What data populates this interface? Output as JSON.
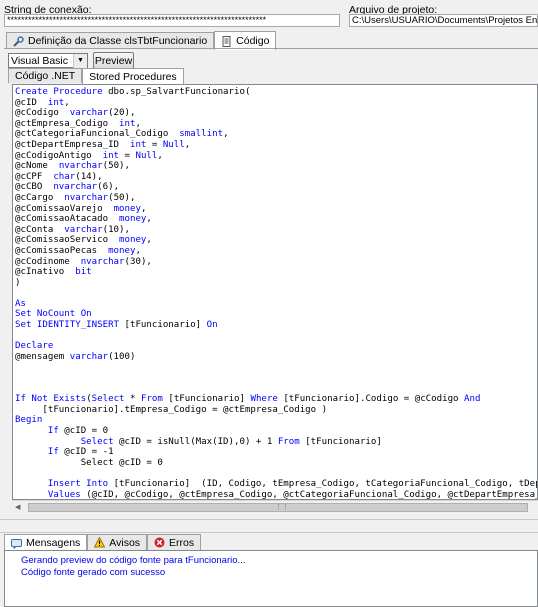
{
  "connection": {
    "label": "String de conexão:",
    "value": "**************************************************************************"
  },
  "project": {
    "label": "Arquivo de projeto:",
    "value": "C:\\Users\\USUARIO\\Documents\\Projetos Entity\\SGLPDES"
  },
  "top_tabs": [
    {
      "label": "Definição da Classe clsTbtFuncionario",
      "icon": "wrench-icon"
    },
    {
      "label": "Código",
      "icon": "page-icon"
    }
  ],
  "language": {
    "selected": "Visual Basic",
    "preview_label": "Preview"
  },
  "code_tabs": [
    {
      "label": "Código .NET"
    },
    {
      "label": "Stored Procedures"
    }
  ],
  "code_lines": [
    [
      [
        "kw",
        "Create Procedure "
      ],
      [
        "tx",
        "dbo.sp_SalvartFuncionario("
      ]
    ],
    [
      [
        "tx",
        "@cID  "
      ],
      [
        "kw",
        "int"
      ],
      [
        "tx",
        ","
      ]
    ],
    [
      [
        "tx",
        "@cCodigo  "
      ],
      [
        "kw",
        "varchar"
      ],
      [
        "tx",
        "(20),"
      ]
    ],
    [
      [
        "tx",
        "@ctEmpresa_Codigo  "
      ],
      [
        "kw",
        "int"
      ],
      [
        "tx",
        ","
      ]
    ],
    [
      [
        "tx",
        "@ctCategoriaFuncional_Codigo  "
      ],
      [
        "kw",
        "smallint"
      ],
      [
        "tx",
        ","
      ]
    ],
    [
      [
        "tx",
        "@ctDepartEmpresa_ID  "
      ],
      [
        "kw",
        "int"
      ],
      [
        "tx",
        " = "
      ],
      [
        "kw",
        "Null"
      ],
      [
        "tx",
        ","
      ]
    ],
    [
      [
        "tx",
        "@cCodigoAntigo  "
      ],
      [
        "kw",
        "int"
      ],
      [
        "tx",
        " = "
      ],
      [
        "kw",
        "Null"
      ],
      [
        "tx",
        ","
      ]
    ],
    [
      [
        "tx",
        "@cNome  "
      ],
      [
        "kw",
        "nvarchar"
      ],
      [
        "tx",
        "(50),"
      ]
    ],
    [
      [
        "tx",
        "@cCPF  "
      ],
      [
        "kw",
        "char"
      ],
      [
        "tx",
        "(14),"
      ]
    ],
    [
      [
        "tx",
        "@cCBO  "
      ],
      [
        "kw",
        "nvarchar"
      ],
      [
        "tx",
        "(6),"
      ]
    ],
    [
      [
        "tx",
        "@cCargo  "
      ],
      [
        "kw",
        "nvarchar"
      ],
      [
        "tx",
        "(50),"
      ]
    ],
    [
      [
        "tx",
        "@cComissaoVarejo  "
      ],
      [
        "kw",
        "money"
      ],
      [
        "tx",
        ","
      ]
    ],
    [
      [
        "tx",
        "@cComissaoAtacado  "
      ],
      [
        "kw",
        "money"
      ],
      [
        "tx",
        ","
      ]
    ],
    [
      [
        "tx",
        "@cConta  "
      ],
      [
        "kw",
        "varchar"
      ],
      [
        "tx",
        "(10),"
      ]
    ],
    [
      [
        "tx",
        "@cComissaoServico  "
      ],
      [
        "kw",
        "money"
      ],
      [
        "tx",
        ","
      ]
    ],
    [
      [
        "tx",
        "@cComissaoPecas  "
      ],
      [
        "kw",
        "money"
      ],
      [
        "tx",
        ","
      ]
    ],
    [
      [
        "tx",
        "@cCodinome  "
      ],
      [
        "kw",
        "nvarchar"
      ],
      [
        "tx",
        "(30),"
      ]
    ],
    [
      [
        "tx",
        "@cInativo  "
      ],
      [
        "kw",
        "bit"
      ]
    ],
    [
      [
        "tx",
        ")"
      ]
    ],
    [],
    [
      [
        "kw",
        "As"
      ]
    ],
    [
      [
        "kw",
        "Set NoCount On"
      ]
    ],
    [
      [
        "kw",
        "Set IDENTITY_INSERT "
      ],
      [
        "tx",
        "[tFuncionario] "
      ],
      [
        "kw",
        "On"
      ]
    ],
    [],
    [
      [
        "kw",
        "Declare"
      ]
    ],
    [
      [
        "tx",
        "@mensagem "
      ],
      [
        "kw",
        "varchar"
      ],
      [
        "tx",
        "(100)"
      ]
    ],
    [],
    [],
    [],
    [
      [
        "kw",
        "If Not Exists"
      ],
      [
        "tx",
        "("
      ],
      [
        "kw",
        "Select"
      ],
      [
        "tx",
        " * "
      ],
      [
        "kw",
        "From"
      ],
      [
        "tx",
        " [tFuncionario] "
      ],
      [
        "kw",
        "Where"
      ],
      [
        "tx",
        " [tFuncionario].Codigo = @cCodigo "
      ],
      [
        "kw",
        "And"
      ]
    ],
    [
      [
        "tx",
        "     [tFuncionario].tEmpresa_Codigo = @ctEmpresa_Codigo )"
      ]
    ],
    [
      [
        "kw",
        "Begin"
      ]
    ],
    [
      [
        "tx",
        "      "
      ],
      [
        "kw",
        "If"
      ],
      [
        "tx",
        " @cID = 0"
      ]
    ],
    [
      [
        "tx",
        "            "
      ],
      [
        "kw",
        "Select"
      ],
      [
        "tx",
        " @cID = isNull(Max(ID),0) + 1 "
      ],
      [
        "kw",
        "From"
      ],
      [
        "tx",
        " [tFuncionario]"
      ]
    ],
    [
      [
        "tx",
        "      "
      ],
      [
        "kw",
        "If"
      ],
      [
        "tx",
        " @cID = -1"
      ]
    ],
    [
      [
        "tx",
        "            Select @cID = 0"
      ]
    ],
    [],
    [
      [
        "tx",
        "      "
      ],
      [
        "kw",
        "Insert Into"
      ],
      [
        "tx",
        " [tFuncionario]  (ID, Codigo, tEmpresa_Codigo, tCategoriaFuncional_Codigo, tDepart"
      ]
    ],
    [
      [
        "tx",
        "      "
      ],
      [
        "kw",
        "Values"
      ],
      [
        "tx",
        " (@cID, @cCodigo, @ctEmpresa_Codigo, @ctCategoriaFuncional_Codigo, @ctDepartEmpresa_ID,"
      ]
    ]
  ],
  "bottom_tabs": [
    {
      "label": "Mensagens",
      "icon": "message-icon"
    },
    {
      "label": "Avisos",
      "icon": "warning-icon"
    },
    {
      "label": "Erros",
      "icon": "error-icon"
    }
  ],
  "messages": [
    "Gerando preview do código fonte para tFuncionario...",
    "Código fonte gerado com sucesso"
  ]
}
